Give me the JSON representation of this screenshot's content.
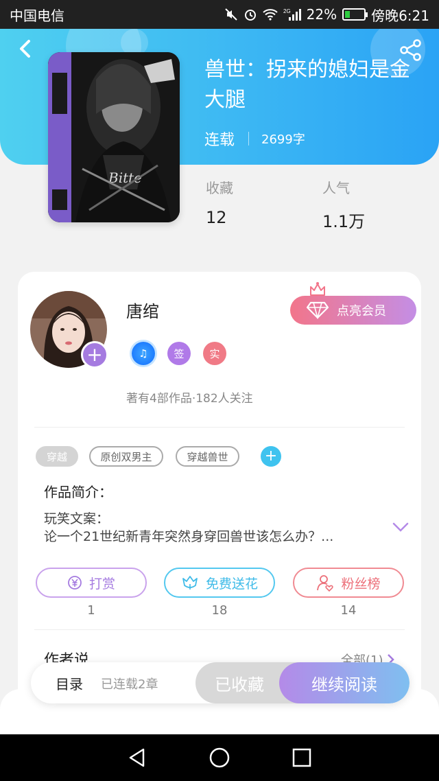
{
  "status_bar": {
    "carrier": "中国电信",
    "network_label": "2G",
    "battery_percent": "22%",
    "time": "傍晚6:21"
  },
  "book": {
    "title": "兽世：拐来的媳妇是金大腿",
    "status": "连载",
    "word_count": "2699字",
    "stats": [
      {
        "label": "收藏",
        "value": "12"
      },
      {
        "label": "人气",
        "value": "1.1万"
      }
    ]
  },
  "author": {
    "name": "唐绾",
    "badges": [
      {
        "icon": "music-note-icon",
        "text": "♫"
      },
      {
        "icon": "sign-badge",
        "text": "签"
      },
      {
        "icon": "real-badge",
        "text": "实"
      }
    ],
    "info": "著有4部作品·182人关注",
    "vip_button": "点亮会员"
  },
  "tags": [
    "穿越",
    "原创双男主",
    "穿越兽世"
  ],
  "intro": {
    "title": "作品简介：",
    "line1": "玩笑文案：",
    "line2": "论一个21世纪新青年突然身穿回兽世该怎么办？..."
  },
  "actions": [
    {
      "label": "打赏",
      "count": "1",
      "icon": "yuan-coin-icon"
    },
    {
      "label": "免费送花",
      "count": "18",
      "icon": "flower-icon"
    },
    {
      "label": "粉丝榜",
      "count": "14",
      "icon": "fan-user-icon"
    }
  ],
  "author_says": {
    "title": "作者说",
    "all_link": "全部(1)"
  },
  "bottom_bar": {
    "toc": "目录",
    "chapters": "已连载2章",
    "collected": "已收藏",
    "continue": "继续阅读"
  },
  "colors": {
    "header_gradient_start": "#4fd0f0",
    "header_gradient_end": "#2aa3f5",
    "vip_gradient_start": "#f2758a",
    "vip_gradient_end": "#c48ee5",
    "reward_purple": "#a57be0",
    "flower_cyan": "#3fbbe8",
    "fans_red": "#ec6f79"
  }
}
